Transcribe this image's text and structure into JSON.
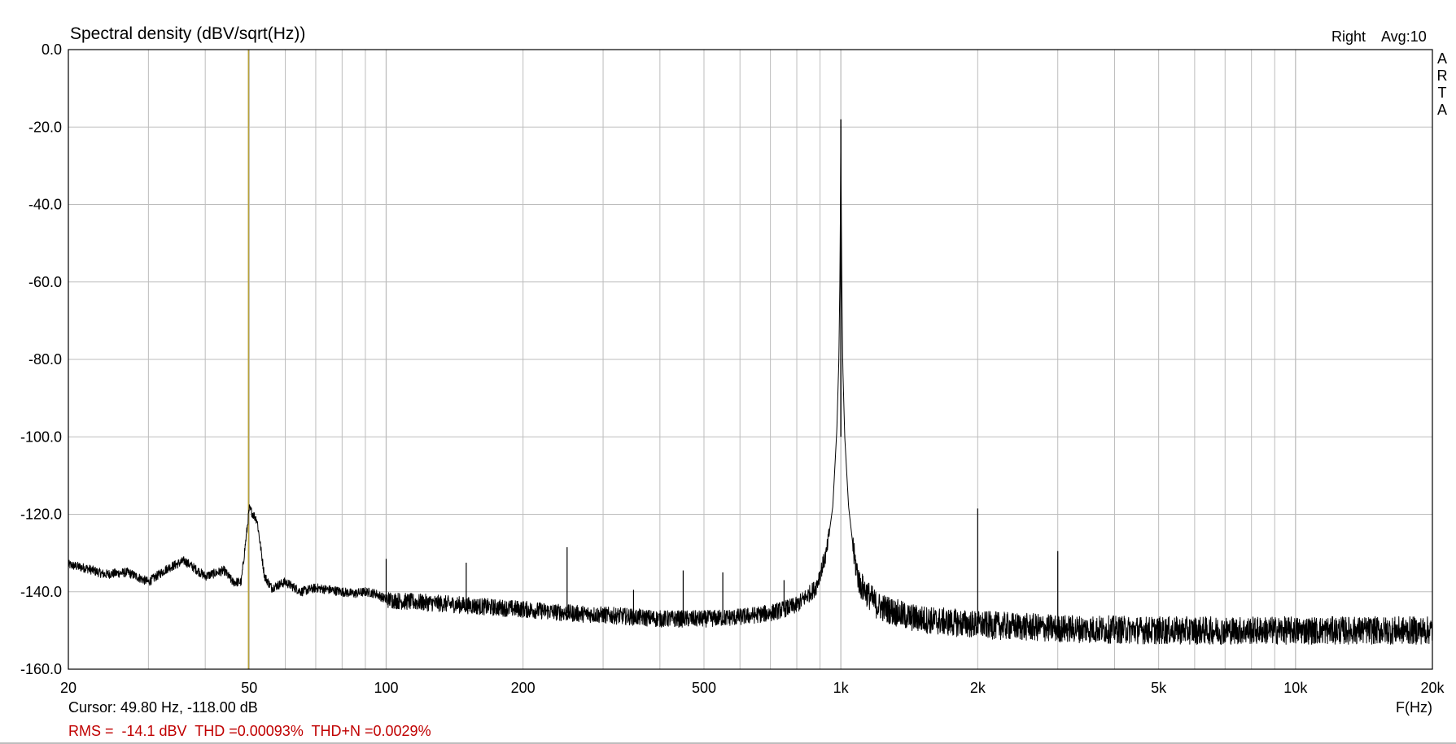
{
  "window": {
    "title": "Spectral density (dBV/sqrt(Hz))",
    "channel_label": "Right",
    "avg_label": "Avg:10",
    "watermark": [
      "A",
      "R",
      "T",
      "A"
    ]
  },
  "status": {
    "cursor_text": "Cursor: 49.80 Hz, -118.00 dB",
    "measurements_text": "RMS =  -14.1 dBV  THD =0.00093%  THD+N =0.0029%"
  },
  "colors": {
    "trace": "#000000",
    "grid": "#bdbdbd",
    "frame": "#000000",
    "cursor": "#b8a13a",
    "measurements": "#c00000"
  },
  "chart_data": {
    "type": "line",
    "title": "Spectral density (dBV/sqrt(Hz))",
    "xlabel": "F(Hz)",
    "ylabel": "",
    "x_scale": "log",
    "xlim": [
      20,
      20000
    ],
    "ylim": [
      -160,
      0
    ],
    "grid": true,
    "x_ticks": [
      20,
      50,
      100,
      200,
      500,
      1000,
      2000,
      5000,
      10000,
      20000
    ],
    "x_tick_labels": [
      "20",
      "50",
      "100",
      "200",
      "500",
      "1k",
      "2k",
      "5k",
      "10k",
      "20k"
    ],
    "y_ticks": [
      0,
      -20,
      -40,
      -60,
      -80,
      -100,
      -120,
      -140,
      -160
    ],
    "y_tick_labels": [
      "0.0",
      "-20.0",
      "-40.0",
      "-60.0",
      "-80.0",
      "-100.0",
      "-120.0",
      "-140.0",
      "-160.0"
    ],
    "cursor": {
      "x": 49.8,
      "y": -118.0
    },
    "series": [
      {
        "noise_floor": [
          [
            20,
            -133
          ],
          [
            22,
            -134
          ],
          [
            24,
            -135.5
          ],
          [
            27,
            -135
          ],
          [
            30,
            -137.5
          ],
          [
            33,
            -134
          ],
          [
            36,
            -132
          ],
          [
            40,
            -136
          ],
          [
            44,
            -134.5
          ],
          [
            46,
            -137.5
          ],
          [
            48,
            -137.5
          ],
          [
            50,
            -118.5
          ],
          [
            52,
            -121.5
          ],
          [
            54,
            -136
          ],
          [
            56,
            -139
          ],
          [
            60,
            -137.5
          ],
          [
            65,
            -140
          ],
          [
            70,
            -139
          ],
          [
            75,
            -139.5
          ],
          [
            80,
            -140
          ],
          [
            85,
            -140.5
          ],
          [
            90,
            -140
          ],
          [
            95,
            -140.5
          ],
          [
            100,
            -142
          ],
          [
            110,
            -142.5
          ],
          [
            130,
            -143
          ],
          [
            150,
            -143.5
          ],
          [
            170,
            -144
          ],
          [
            200,
            -144.5
          ],
          [
            250,
            -145.5
          ],
          [
            300,
            -146
          ],
          [
            350,
            -146.5
          ],
          [
            400,
            -147
          ],
          [
            500,
            -147
          ],
          [
            600,
            -146.5
          ],
          [
            700,
            -145.5
          ],
          [
            800,
            -143.5
          ],
          [
            880,
            -139
          ],
          [
            930,
            -130
          ],
          [
            960,
            -118
          ],
          [
            980,
            -98
          ],
          [
            990,
            -80
          ],
          [
            995,
            -60
          ],
          [
            998,
            -40
          ],
          [
            1000,
            -18
          ],
          [
            1002,
            -40
          ],
          [
            1005,
            -60
          ],
          [
            1010,
            -82
          ],
          [
            1020,
            -100
          ],
          [
            1040,
            -118
          ],
          [
            1070,
            -131
          ],
          [
            1100,
            -138
          ],
          [
            1200,
            -143.5
          ],
          [
            1400,
            -146.5
          ],
          [
            1600,
            -147.5
          ],
          [
            2000,
            -148.5
          ],
          [
            3000,
            -149.5
          ],
          [
            5000,
            -150
          ],
          [
            10000,
            -150
          ],
          [
            20000,
            -150
          ]
        ],
        "spurs": [
          [
            100,
            -131.5
          ],
          [
            150,
            -132.5
          ],
          [
            250,
            -128.5
          ],
          [
            350,
            -139.5
          ],
          [
            450,
            -134.5
          ],
          [
            550,
            -135
          ],
          [
            750,
            -137
          ],
          [
            2000,
            -118.5
          ],
          [
            3000,
            -129.5
          ]
        ]
      }
    ]
  }
}
